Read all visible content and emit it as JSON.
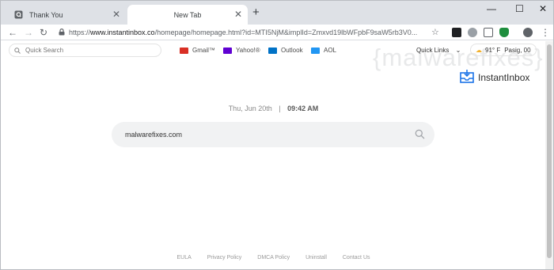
{
  "tabs": [
    {
      "title": "Thank You",
      "active": false
    },
    {
      "title": "New Tab",
      "active": true
    }
  ],
  "toolbar": {
    "url_prefix": "https://",
    "url_host": "www.instantinbox.co",
    "url_path": "/homepage/homepage.html?id=MTI5NjM&implId=Zmxvd19lbWFpbF9saW5rb3V0..."
  },
  "page": {
    "quick_search_placeholder": "Quick Search",
    "mail_links": [
      {
        "label": "Gmail™",
        "color": "#d93025"
      },
      {
        "label": "Yahoo!®",
        "color": "#6001d2"
      },
      {
        "label": "Outlook",
        "color": "#0072c6"
      },
      {
        "label": "AOL",
        "color": "#2196f3"
      }
    ],
    "quick_links_label": "Quick Links",
    "weather": {
      "temp": "91° F",
      "location": "Pasig, 00"
    },
    "brand_name": "InstantInbox",
    "watermark": "{malwarefixes}",
    "date": "Thu, Jun 20th",
    "separator": "|",
    "time": "09:42 AM",
    "search_value": "malwarefixes.com",
    "footer_links": [
      "EULA",
      "Privacy Policy",
      "DMCA Policy",
      "Uninstall",
      "Contact Us"
    ]
  },
  "colors": {
    "accent": "#1a73e8",
    "tab_strip": "#dee1e6"
  }
}
